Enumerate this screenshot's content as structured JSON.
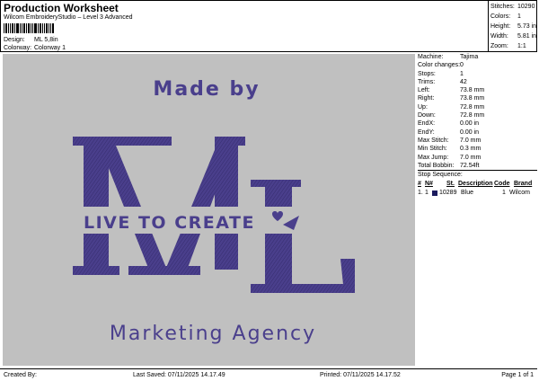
{
  "header": {
    "title": "Production Worksheet",
    "subtitle": "Wilcom EmbroideryStudio – Level 3 Advanced",
    "design_label": "Design:",
    "design_value": "ML 5,8in",
    "colorway_label": "Colorway:",
    "colorway_value": "Colorway 1"
  },
  "stats": [
    {
      "label": "Stitches:",
      "value": "10290"
    },
    {
      "label": "Colors:",
      "value": "1"
    },
    {
      "label": "Height:",
      "value": "5.73 in"
    },
    {
      "label": "Width:",
      "value": "5.81 in"
    },
    {
      "label": "Zoom:",
      "value": "1:1"
    }
  ],
  "specs": [
    {
      "label": "Machine:",
      "value": "Tajima"
    },
    {
      "label": "Color changes:",
      "value": "0"
    },
    {
      "label": "Stops:",
      "value": "1"
    },
    {
      "label": "Trims:",
      "value": "42"
    },
    {
      "label": "Left:",
      "value": "73.8 mm"
    },
    {
      "label": "Right:",
      "value": "73.8 mm"
    },
    {
      "label": "Up:",
      "value": "72.8 mm"
    },
    {
      "label": "Down:",
      "value": "72.8 mm"
    },
    {
      "label": "EndX:",
      "value": "0.00 in"
    },
    {
      "label": "EndY:",
      "value": "0.00 in"
    },
    {
      "label": "Max Stitch:",
      "value": "7.0 mm"
    },
    {
      "label": "Min Stitch:",
      "value": "0.3 mm"
    },
    {
      "label": "Max Jump:",
      "value": "7.0 mm"
    },
    {
      "label": "Total Bobbin:",
      "value": "72.54ft"
    }
  ],
  "stop_sequence": {
    "title": "Stop Sequence:",
    "headers": [
      "#",
      "N#",
      "St.",
      "Description",
      "Code",
      "Brand"
    ],
    "rows": [
      {
        "num": "1.",
        "n": "1",
        "st": "10289",
        "description": "Blue",
        "code": "1",
        "brand": "Wilcom",
        "color": "#1a1a5e"
      }
    ]
  },
  "design_text": {
    "made_by": "Made by",
    "live_to_create": "LIVE TO CREATE",
    "marketing_agency": "Marketing Agency",
    "thread_color": "#4a3f8c",
    "background": "#c0c0c0"
  },
  "footer": {
    "created_by": "Created By:",
    "last_saved": "Last Saved: 07/11/2025 14.17.49",
    "printed": "Printed: 07/11/2025 14.17.52",
    "page": "Page 1 of 1"
  }
}
